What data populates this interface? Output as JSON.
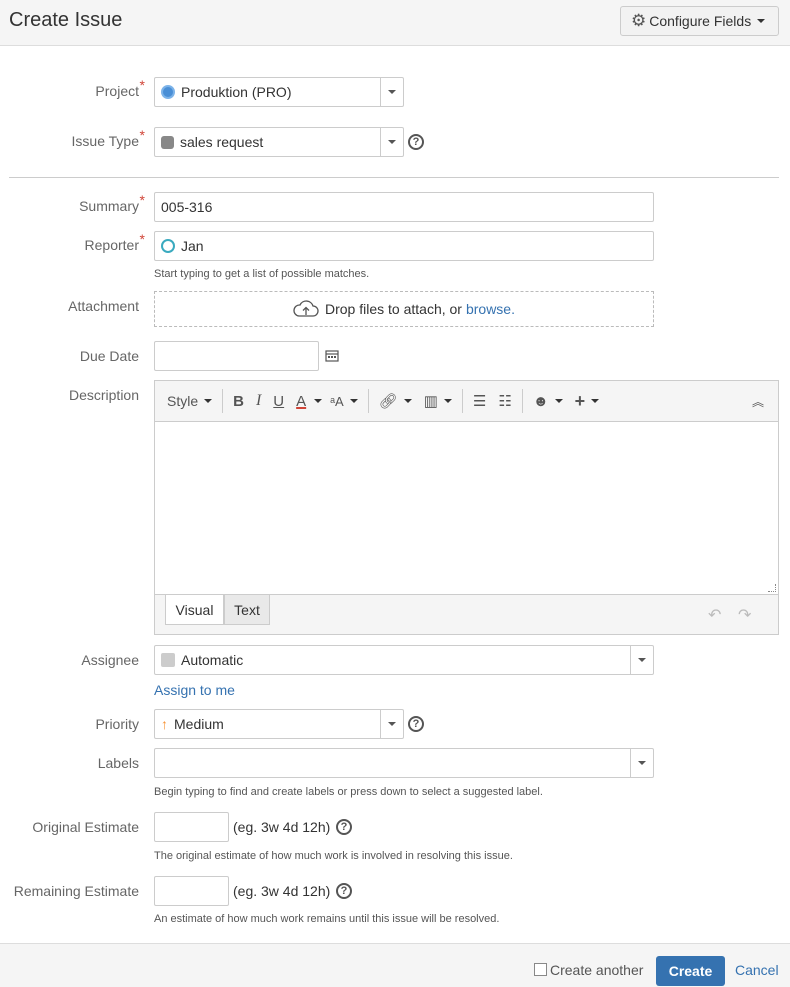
{
  "header": {
    "title": "Create Issue",
    "configure_fields": "Configure Fields"
  },
  "form": {
    "project": {
      "label": "Project",
      "value": "Produktion (PRO)"
    },
    "issue_type": {
      "label": "Issue Type",
      "value": "sales request"
    },
    "summary": {
      "label": "Summary",
      "value": "005-316"
    },
    "reporter": {
      "label": "Reporter",
      "value": "Jan",
      "hint": "Start typing to get a list of possible matches."
    },
    "attachment": {
      "label": "Attachment",
      "drop_text": "Drop files to attach, or",
      "browse": "browse."
    },
    "due_date": {
      "label": "Due Date",
      "value": ""
    },
    "description": {
      "label": "Description",
      "toolbar": {
        "style": "Style"
      },
      "tabs": {
        "visual": "Visual",
        "text": "Text"
      }
    },
    "assignee": {
      "label": "Assignee",
      "value": "Automatic",
      "assign_to_me": "Assign to me"
    },
    "priority": {
      "label": "Priority",
      "value": "Medium"
    },
    "labels": {
      "label": "Labels",
      "value": "",
      "hint": "Begin typing to find and create labels or press down to select a suggested label."
    },
    "original_estimate": {
      "label": "Original Estimate",
      "example": "(eg. 3w 4d 12h)",
      "hint": "The original estimate of how much work is involved in resolving this issue."
    },
    "remaining_estimate": {
      "label": "Remaining Estimate",
      "example": "(eg. 3w 4d 12h)",
      "hint": "An estimate of how much work remains until this issue will be resolved."
    }
  },
  "footer": {
    "create_another": "Create another",
    "create": "Create",
    "cancel": "Cancel"
  },
  "colors": {
    "accent": "#3572b0",
    "required": "#d04437",
    "priority_medium": "#f79232"
  }
}
